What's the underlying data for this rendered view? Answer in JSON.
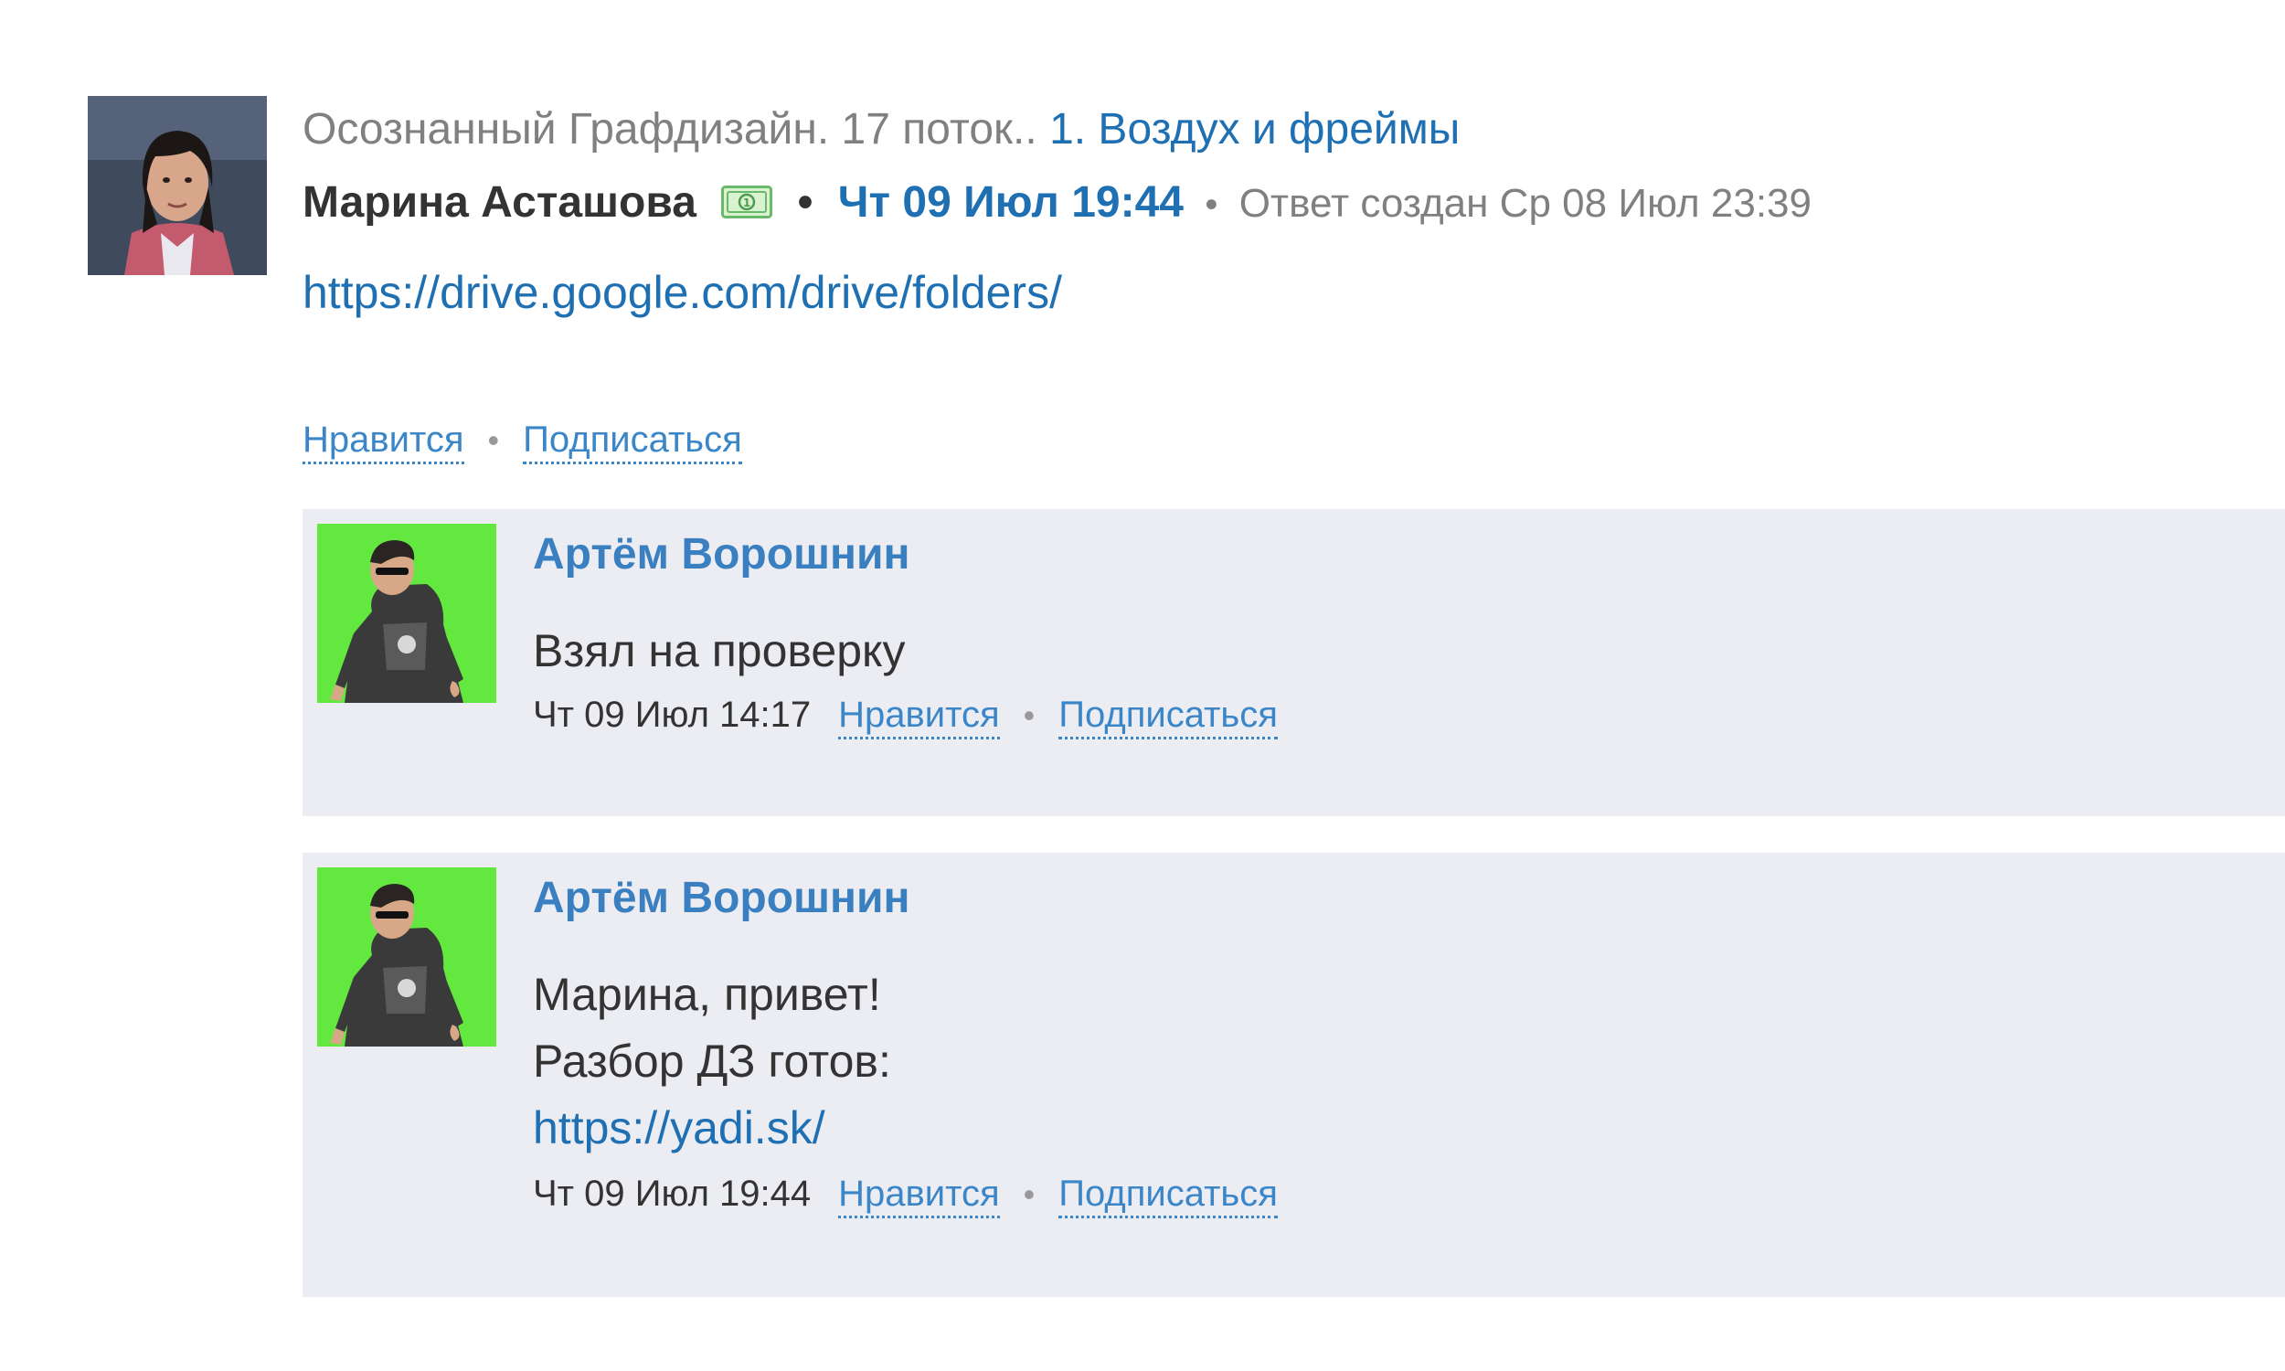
{
  "post": {
    "course": "Осознанный Графдизайн. 17 поток.. ",
    "lesson": "1. Воздух и фреймы",
    "author": "Марина Асташова",
    "separator": "•",
    "date": "Чт 09 Июл 19:44",
    "created_label": "Ответ создан Ср 08 Июл 23:39",
    "link": "https://drive.google.com/drive/folders/",
    "actions": {
      "like": "Нравится",
      "subscribe": "Подписаться"
    }
  },
  "comments": [
    {
      "author": "Артём Ворошнин",
      "lines": [
        "Взял на проверку"
      ],
      "time": "Чт 09 Июл 14:17",
      "like": "Нравится",
      "subscribe": "Подписаться"
    },
    {
      "author": "Артём Ворошнин",
      "lines": [
        "Марина, привет!",
        "Разбор ДЗ готов:"
      ],
      "link": "https://yadi.sk/",
      "time": "Чт 09 Июл 19:44",
      "like": "Нравится",
      "subscribe": "Подписаться"
    }
  ],
  "icons": {
    "money_badge": "money-badge-icon",
    "action_separator": "•"
  },
  "colors": {
    "link_blue": "#1f6fb3",
    "action_blue": "#3a86c8",
    "comment_bg": "#ecedf3",
    "avatar_green": "#63e840",
    "muted_gray": "#808080"
  }
}
